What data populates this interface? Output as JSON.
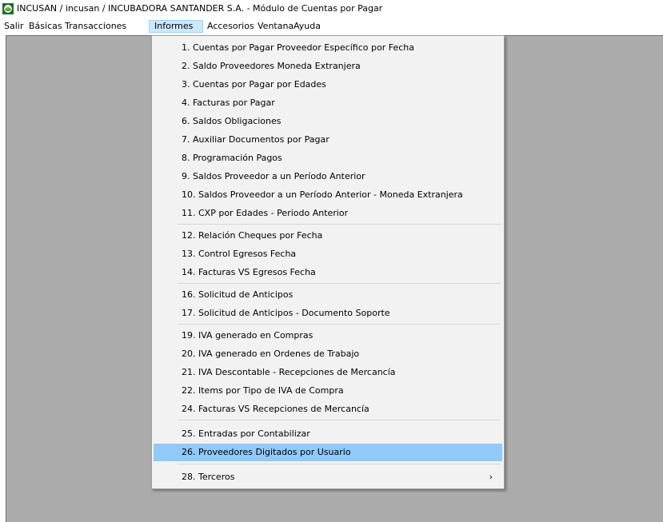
{
  "window": {
    "title": "INCUSAN / incusan / INCUBADORA SANTANDER S.A. - Módulo de Cuentas por Pagar",
    "icon": "app-logo-icon"
  },
  "menubar": {
    "items": [
      {
        "label": "Salir"
      },
      {
        "label": "Básicas"
      },
      {
        "label": "Transacciones"
      },
      {
        "label": "Informes"
      },
      {
        "label": "Accesorios"
      },
      {
        "label": "Ventana"
      },
      {
        "label": "Ayuda"
      }
    ],
    "active_item": "Informes"
  },
  "informes_menu": {
    "highlighted_item": "26. Proveedores Digitados por Usuario",
    "submenu_arrow": "›",
    "items": [
      {
        "label": "1. Cuentas por Pagar Proveedor Específico por Fecha"
      },
      {
        "label": "2. Saldo Proveedores Moneda Extranjera"
      },
      {
        "label": "3. Cuentas por Pagar por Edades"
      },
      {
        "label": "4. Facturas por Pagar"
      },
      {
        "label": "6. Saldos Obligaciones"
      },
      {
        "label": "7. Auxiliar Documentos por Pagar"
      },
      {
        "label": "8. Programación Pagos"
      },
      {
        "label": "9. Saldos Proveedor a un Período Anterior"
      },
      {
        "label": "10. Saldos Proveedor a un Período Anterior - Moneda Extranjera"
      },
      {
        "label": "11. CXP por Edades - Periodo Anterior"
      },
      {
        "label": "12. Relación Cheques por Fecha"
      },
      {
        "label": "13. Control Egresos Fecha"
      },
      {
        "label": "14. Facturas VS Egresos Fecha"
      },
      {
        "label": "16. Solicitud de Anticipos"
      },
      {
        "label": "17. Solicitud de Anticipos  - Documento Soporte"
      },
      {
        "label": "19. IVA generado en Compras"
      },
      {
        "label": "20. IVA generado en Ordenes de Trabajo"
      },
      {
        "label": "21. IVA Descontable - Recepciones de Mercancía"
      },
      {
        "label": "22. Items por Tipo de IVA de Compra"
      },
      {
        "label": "24. Facturas VS Recepciones de Mercancía"
      },
      {
        "label": "25. Entradas por Contabilizar"
      },
      {
        "label": "26. Proveedores Digitados por Usuario"
      },
      {
        "label": "28. Terceros"
      }
    ]
  },
  "colors": {
    "workspace": "#ababab",
    "menu_background": "#f2f2f2",
    "highlight": "#91c9f7",
    "menubar_active": "#cce8ff"
  }
}
